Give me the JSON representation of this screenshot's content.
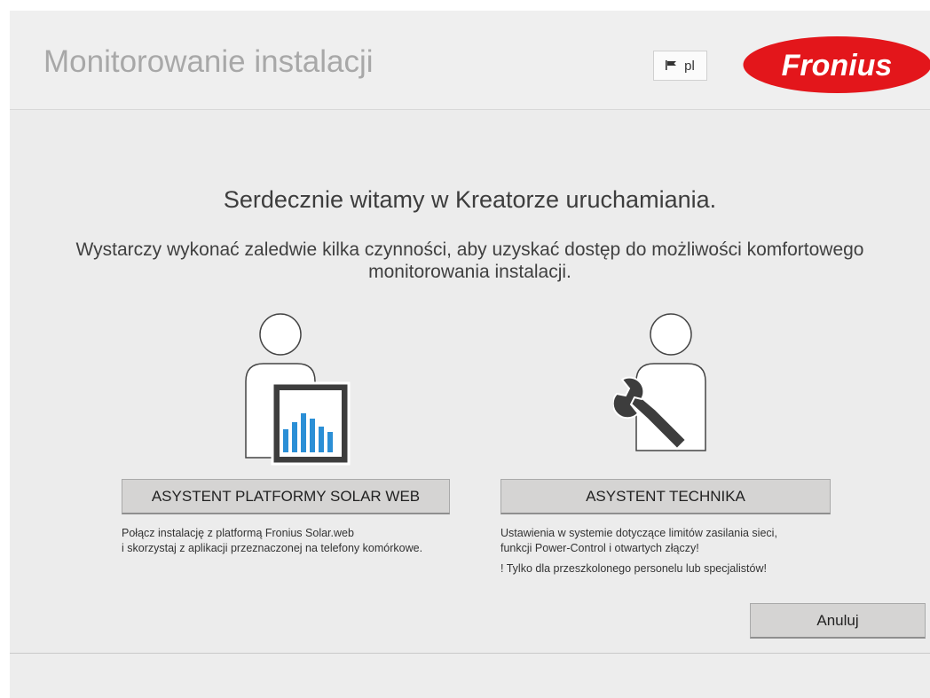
{
  "header": {
    "title": "Monitorowanie instalacji",
    "language": "pl",
    "brand": "Fronius"
  },
  "colors": {
    "brand_red": "#e3161b",
    "chart_blue": "#2b8fd6",
    "title_gray": "#a8a8a8"
  },
  "main": {
    "welcome": "Serdecznie witamy w Kreatorze uruchamiania.",
    "intro": "Wystarczy wykonać zaledwie kilka czynności, aby uzyskać dostęp do możliwości komfortowego monitorowania instalacji.",
    "solarweb": {
      "button": "ASYSTENT PLATFORMY SOLAR WEB",
      "desc_line1": "Połącz instalację z platformą Fronius Solar.web",
      "desc_line2": "i skorzystaj z aplikacji przeznaczonej na telefony komórkowe."
    },
    "technician": {
      "button": "ASYSTENT TECHNIKA",
      "desc_line1": "Ustawienia w systemie dotyczące limitów zasilania sieci,",
      "desc_line2": "funkcji Power-Control i otwartych złączy!",
      "warning": "! Tylko dla przeszkolonego personelu lub specjalistów!"
    },
    "cancel": "Anuluj"
  }
}
